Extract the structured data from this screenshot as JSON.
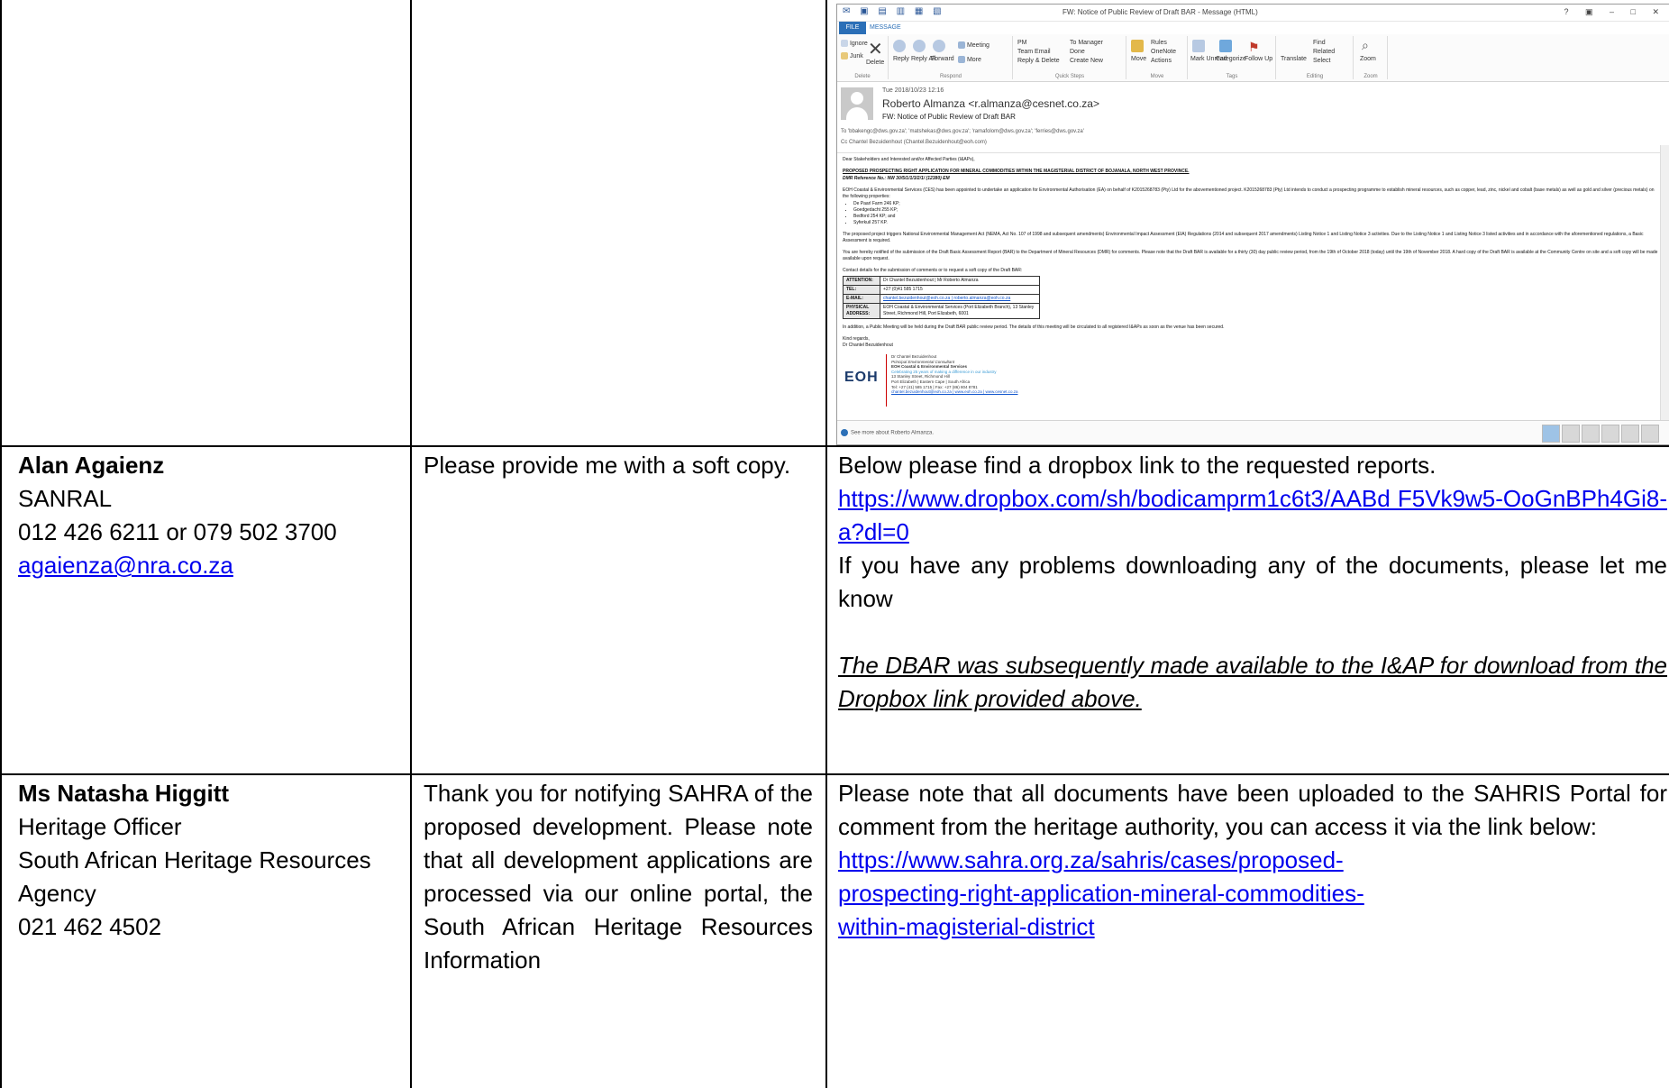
{
  "outlook": {
    "window_title": "FW: Notice of Public Review of Draft BAR - Message (HTML)",
    "window_controls": "? ▣ – □ ✕",
    "tab_file": "FILE",
    "tab_message": "MESSAGE",
    "ribbon": {
      "delete": {
        "ignore": "Ignore",
        "junk": "Junk",
        "delete": "Delete",
        "label": "Delete"
      },
      "respond": {
        "reply": "Reply",
        "reply_all": "Reply All",
        "forward": "Forward",
        "meeting": "Meeting",
        "more": "More",
        "label": "Respond"
      },
      "quick_steps": {
        "pm": "PM",
        "team_email": "Team Email",
        "reply_delete": "Reply & Delete",
        "to_manager": "To Manager",
        "done": "Done",
        "create_new": "Create New",
        "label": "Quick Steps"
      },
      "move": {
        "move": "Move",
        "rules": "Rules",
        "onenote": "OneNote",
        "actions": "Actions",
        "label": "Move"
      },
      "tags": {
        "mark_unread": "Mark Unread",
        "categorize": "Categorize",
        "follow_up": "Follow Up",
        "label": "Tags"
      },
      "editing": {
        "translate": "Translate",
        "find": "Find",
        "related": "Related",
        "select": "Select",
        "label": "Editing"
      },
      "zoom": {
        "zoom": "Zoom",
        "label": "Zoom"
      }
    },
    "header": {
      "date": "Tue 2018/10/23 12:16",
      "from": "Roberto Almanza <r.almanza@cesnet.co.za>",
      "subject": "FW: Notice of Public Review of Draft BAR",
      "to": "To   'bbakengc@dws.gov.za'; 'matshekas@dws.gov.za'; 'ramafolom@dws.gov.za'; 'ferries@dws.gov.za'",
      "cc": "Cc   Chantel Bezuidenhout (Chantel.Bezuidenhout@eoh.com)"
    },
    "body": {
      "greeting": "Dear Stakeholders and Interested and/or Affected Parties (I&APs),",
      "heading": "PROPOSED PROSPECTING RIGHT APPLICATION FOR MINERAL COMMODITIES WITHIN THE MAGISTERIAL DISTRICT OF BOJANALA, NORTH WEST PROVINCE.",
      "dmr_ref": "DMR Reference No.: NW 30/5/1/1/3/2/1/ (12380) EM",
      "para1": "EOH Coastal & Environmental Services (CES) has been appointed to undertake an application for Environmental Authorisation (EA) on behalf of K2015268783 (Pty) Ltd for the abovementioned project. K2015268783 (Pty) Ltd intends to conduct a prospecting programme to establish mineral resources, such as copper, lead, zinc, nickel and cobalt (base metals) as well as gold and silver (precious metals) on the following properties:",
      "farms": [
        "De Paarl Farm 246 KP;",
        "Goedgedacht 255 KP;",
        "Bedford 254 KP; and",
        "Syferkuil 257 KP."
      ],
      "para2": "The proposed project triggers National Environmental Management Act (NEMA, Act No. 107 of 1998 and subsequent amendments) Environmental Impact Assessment (EIA) Regulations (2014 and subsequent 2017 amendments) Listing Notice 1 and Listing Notice 3 activities. Due to the Listing Notice 1 and Listing Notice 3 listed activities and in accordance with the aforementioned regulations, a Basic Assessment is required.",
      "para3": "You are hereby notified of the submission of the Draft Basic Assessment Report (BAR) to the Department of Mineral Resources (DMR) for comments. Please note that the Draft BAR is available for a thirty (30) day public review period, from the 19th of October 2018 (today) until the 19th of November 2018. A hard copy of the Draft BAR is available at the Community Centre on site and a soft copy will be made available upon request.",
      "para4": "Contact details for the submission of comments or to request a soft copy of the Draft BAR:",
      "contacts": [
        {
          "k": "ATTENTION:",
          "v": "Dr Chantel Bezuidenhout | Mr Roberto Almanza"
        },
        {
          "k": "TEL:",
          "v": "+27 (0)41 585 1715"
        },
        {
          "k": "E-MAIL:",
          "v": "chantel.bezuidenhout@eoh.co.za | roberto.almanza@eoh.co.za"
        },
        {
          "k": "PHYSICAL ADDRESS:",
          "v": "EOH Coastal & Environmental Services (Port Elizabeth Branch), 13 Stanley Street, Richmond Hill, Port Elizabeth, 6001"
        }
      ],
      "para5": "In addition, a Public Meeting will be held during the Draft BAR public review period. The details of this meeting will be circulated to all registered I&APs as soon as the venue has been secured.",
      "closing1": "Kind regards,",
      "closing2": "Dr Chantel Bezuidenhout",
      "logo": "EOH",
      "signature": [
        "Dr Chantel Bezuidenhout",
        "Principal Environmental Consultant",
        "EOH Coastal & Environmental Services",
        "Celebrating 25 years of making a difference in our industry",
        "13 Stanley Street, Richmond Hill",
        "Port Elizabeth | Eastern Cape | South Africa",
        "Tel: +27 (41) 585 1715 | Fax: +27 (86) 804 8781",
        "chantel.bezuidenhout@eoh.co.za | www.eoh.co.za | www.cesnet.co.za"
      ]
    },
    "people_pane": "See more about Roberto Almanza."
  },
  "rows": [
    {
      "name": "Alan Agaienz",
      "org_lines": [
        "SANRAL",
        "012 426 6211 or 079 502 3700"
      ],
      "email": "agaienza@nra.co.za",
      "comment": "Please provide me with a soft copy.",
      "response_text1": "Below please find a dropbox link to the requested reports.",
      "response_link": "https://www.dropbox.com/sh/bodicamprm1c6t3/AABd F5Vk9w5-OoGnBPh4Gi8-a?dl=0",
      "response_text2": "If you have any problems downloading any of the documents, please let me know",
      "response_italic": "The DBAR was subsequently made available to the I&AP for download from the Dropbox link provided above."
    },
    {
      "name": "Ms Natasha Higgitt",
      "org_lines": [
        "Heritage Officer",
        "South African Heritage Resources Agency",
        "021 462 4502"
      ],
      "comment": "Thank you for notifying SAHRA of the proposed development. Please note that all development applications are processed via our online portal, the South African Heritage Resources Information",
      "response_text1": "Please note that all documents have been uploaded to the SAHRIS Portal for comment from the heritage authority, you can access it via the link below:",
      "response_link": "https://www.sahra.org.za/sahris/cases/proposed-prospecting-right-application-mineral-commodities-within-magisterial-district"
    }
  ]
}
